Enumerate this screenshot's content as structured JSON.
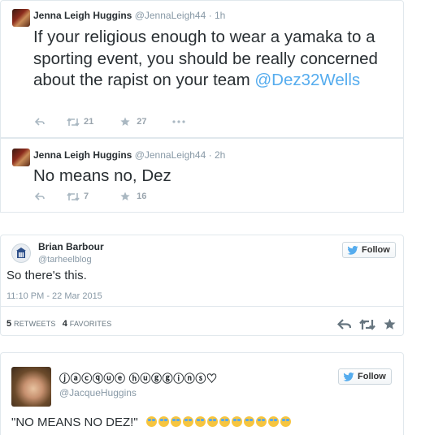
{
  "tweet1": {
    "name": "Jenna Leigh Huggins",
    "handle": "@JennaLeigh44",
    "time": "· 1h",
    "text": "If your religious enough to wear a yamaka to a sporting event, you should be really concerned about the rapist on your team ",
    "mention": "@Dez32Wells",
    "retweets": "21",
    "favorites": "27"
  },
  "tweet2": {
    "name": "Jenna Leigh Huggins",
    "handle": "@JennaLeigh44",
    "time": "· 2h",
    "text": "No means no, Dez",
    "retweets": "7",
    "favorites": "16"
  },
  "tweet3": {
    "name": "Brian Barbour",
    "handle": "@tarheelblog",
    "follow_label": "Follow",
    "text": "So there's this.",
    "timestamp": "11:10 PM - 22 Mar 2015",
    "retweet_count": "5",
    "retweet_label": "RETWEETS",
    "favorite_count": "4",
    "favorite_label": "FAVORITES"
  },
  "tweet4": {
    "name": "ⓙⓐⓒⓠⓤⓔ ⓗⓤⓖⓖⓘⓝⓢ♡",
    "handle": "@JacqueHuggins",
    "follow_label": "Follow",
    "text": "\"NO MEANS NO DEZ!\"",
    "emoji_count": 12
  },
  "colors": {
    "link": "#55acee",
    "twitter_bird": "#55acee",
    "muted": "#8899a6"
  }
}
